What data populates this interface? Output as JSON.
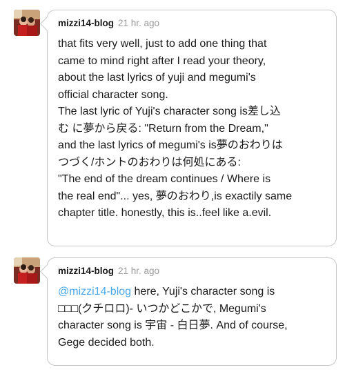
{
  "replies": [
    {
      "username": "mizzi14-blog",
      "timestamp": "21 hr. ago",
      "lines": [
        "that fits very well, just to add one thing that",
        "came to mind right after I read your theory,",
        "about the last lyrics of yuji and megumi's",
        "official character song.",
        "The last lyric of Yuji's character song is差し込",
        "む に夢から戻る: \"Return from the Dream,\"",
        "and the last lyrics of megumi's is夢のおわりは",
        "つづく/ホントのおわりは何処にある:",
        "\"The end of the dream continues / Where is",
        "the real end\"... yes, 夢のおわり,is exactily same",
        "chapter title. honestly, this is..feel like a.evil."
      ]
    },
    {
      "username": "mizzi14-blog",
      "timestamp": "21 hr. ago",
      "mention": "@mizzi14-blog",
      "line1_rest": " here, Yuji's character song is",
      "lines": [
        "□□□(クチロロ)- いつかどこかで, Megumi's",
        "character song is 宇宙 - 白日夢. And of course,",
        "Gege decided both."
      ]
    }
  ],
  "colors": {
    "mention": "#4aa8ea",
    "timestamp": "#9a9a9a",
    "border": "#c7c7c7"
  },
  "icons": {
    "avatar": "user-avatar-photo"
  }
}
